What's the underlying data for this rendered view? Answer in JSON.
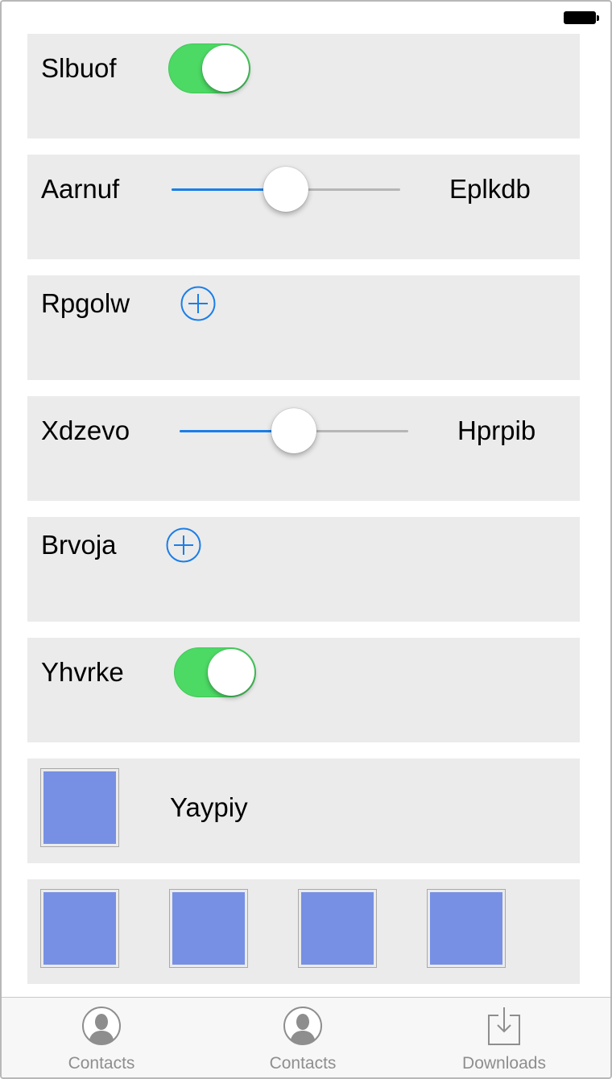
{
  "status_bar": {
    "battery_icon": "battery-full-icon"
  },
  "rows": [
    {
      "type": "toggle",
      "label": "Slbuof",
      "on": true
    },
    {
      "type": "slider",
      "label": "Aarnuf",
      "value_label": "Eplkdb",
      "value": 0.5
    },
    {
      "type": "add",
      "label": "Rpgolw",
      "icon": "plus-circle-icon"
    },
    {
      "type": "slider",
      "label": "Xdzevo",
      "value_label": "Hprpib",
      "value": 0.5
    },
    {
      "type": "add",
      "label": "Brvoja",
      "icon": "plus-circle-icon"
    },
    {
      "type": "toggle",
      "label": "Yhvrke",
      "on": true
    },
    {
      "type": "image-label",
      "label": "Yaypiy",
      "image_color": "#7790e3"
    },
    {
      "type": "image-grid",
      "count": 4,
      "image_color": "#7790e3"
    }
  ],
  "tabbar": {
    "tabs": [
      {
        "label": "Contacts",
        "icon": "contact-icon"
      },
      {
        "label": "Contacts",
        "icon": "contact-icon"
      },
      {
        "label": "Downloads",
        "icon": "download-icon"
      }
    ]
  },
  "colors": {
    "toggle_on": "#4cd964",
    "slider_fill": "#1a7ee8",
    "accent_blue": "#1a7ee8",
    "row_background": "#ebebeb",
    "tab_label": "#8e8e8e"
  }
}
